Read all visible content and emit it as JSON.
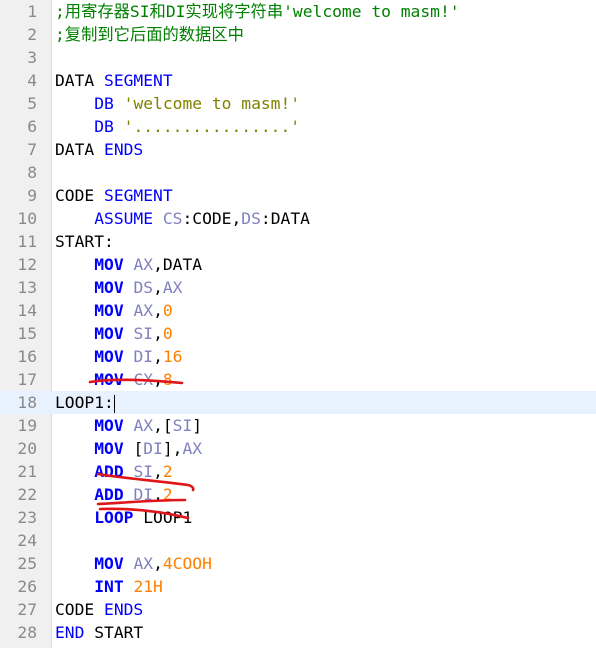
{
  "editor": {
    "current_line": 18,
    "lines": [
      {
        "n": "1",
        "tokens": [
          {
            "t": ";用寄存器SI和DI实现将字符串'welcome to masm!'",
            "k": "comment"
          }
        ]
      },
      {
        "n": "2",
        "tokens": [
          {
            "t": ";复制到它后面的数据区中",
            "k": "comment"
          }
        ]
      },
      {
        "n": "3",
        "tokens": []
      },
      {
        "n": "4",
        "tokens": [
          {
            "t": "DATA ",
            "k": "id"
          },
          {
            "t": "SEGMENT",
            "k": "kw"
          }
        ]
      },
      {
        "n": "5",
        "tokens": [
          {
            "t": "    ",
            "k": "id"
          },
          {
            "t": "DB",
            "k": "kw"
          },
          {
            "t": " ",
            "k": "id"
          },
          {
            "t": "'welcome to masm!'",
            "k": "str"
          }
        ]
      },
      {
        "n": "6",
        "tokens": [
          {
            "t": "    ",
            "k": "id"
          },
          {
            "t": "DB",
            "k": "kw"
          },
          {
            "t": " ",
            "k": "id"
          },
          {
            "t": "'................'",
            "k": "str"
          }
        ]
      },
      {
        "n": "7",
        "tokens": [
          {
            "t": "DATA ",
            "k": "id"
          },
          {
            "t": "ENDS",
            "k": "kw"
          }
        ]
      },
      {
        "n": "8",
        "tokens": []
      },
      {
        "n": "9",
        "tokens": [
          {
            "t": "CODE ",
            "k": "id"
          },
          {
            "t": "SEGMENT",
            "k": "kw"
          }
        ]
      },
      {
        "n": "10",
        "tokens": [
          {
            "t": "    ",
            "k": "id"
          },
          {
            "t": "ASSUME",
            "k": "kw"
          },
          {
            "t": " ",
            "k": "id"
          },
          {
            "t": "CS",
            "k": "reg"
          },
          {
            "t": ":CODE,",
            "k": "id"
          },
          {
            "t": "DS",
            "k": "reg"
          },
          {
            "t": ":DATA",
            "k": "id"
          }
        ]
      },
      {
        "n": "11",
        "tokens": [
          {
            "t": "START:",
            "k": "id"
          }
        ]
      },
      {
        "n": "12",
        "tokens": [
          {
            "t": "    ",
            "k": "id"
          },
          {
            "t": "MOV",
            "k": "kwb"
          },
          {
            "t": " ",
            "k": "id"
          },
          {
            "t": "AX",
            "k": "reg"
          },
          {
            "t": ",DATA",
            "k": "id"
          }
        ]
      },
      {
        "n": "13",
        "tokens": [
          {
            "t": "    ",
            "k": "id"
          },
          {
            "t": "MOV",
            "k": "kwb"
          },
          {
            "t": " ",
            "k": "id"
          },
          {
            "t": "DS",
            "k": "reg"
          },
          {
            "t": ",",
            "k": "id"
          },
          {
            "t": "AX",
            "k": "reg"
          }
        ]
      },
      {
        "n": "14",
        "tokens": [
          {
            "t": "    ",
            "k": "id"
          },
          {
            "t": "MOV",
            "k": "kwb"
          },
          {
            "t": " ",
            "k": "id"
          },
          {
            "t": "AX",
            "k": "reg"
          },
          {
            "t": ",",
            "k": "id"
          },
          {
            "t": "0",
            "k": "num"
          }
        ]
      },
      {
        "n": "15",
        "tokens": [
          {
            "t": "    ",
            "k": "id"
          },
          {
            "t": "MOV",
            "k": "kwb"
          },
          {
            "t": " ",
            "k": "id"
          },
          {
            "t": "SI",
            "k": "reg"
          },
          {
            "t": ",",
            "k": "id"
          },
          {
            "t": "0",
            "k": "num"
          }
        ]
      },
      {
        "n": "16",
        "tokens": [
          {
            "t": "    ",
            "k": "id"
          },
          {
            "t": "MOV",
            "k": "kwb"
          },
          {
            "t": " ",
            "k": "id"
          },
          {
            "t": "DI",
            "k": "reg"
          },
          {
            "t": ",",
            "k": "id"
          },
          {
            "t": "16",
            "k": "num"
          }
        ]
      },
      {
        "n": "17",
        "tokens": [
          {
            "t": "    ",
            "k": "id"
          },
          {
            "t": "MOV",
            "k": "kwb"
          },
          {
            "t": " ",
            "k": "id"
          },
          {
            "t": "CX",
            "k": "reg"
          },
          {
            "t": ",",
            "k": "id"
          },
          {
            "t": "8",
            "k": "num"
          }
        ]
      },
      {
        "n": "18",
        "tokens": [
          {
            "t": "LOOP1:",
            "k": "id"
          }
        ]
      },
      {
        "n": "19",
        "tokens": [
          {
            "t": "    ",
            "k": "id"
          },
          {
            "t": "MOV",
            "k": "kwb"
          },
          {
            "t": " ",
            "k": "id"
          },
          {
            "t": "AX",
            "k": "reg"
          },
          {
            "t": ",[",
            "k": "id"
          },
          {
            "t": "SI",
            "k": "reg"
          },
          {
            "t": "]",
            "k": "id"
          }
        ]
      },
      {
        "n": "20",
        "tokens": [
          {
            "t": "    ",
            "k": "id"
          },
          {
            "t": "MOV",
            "k": "kwb"
          },
          {
            "t": " [",
            "k": "id"
          },
          {
            "t": "DI",
            "k": "reg"
          },
          {
            "t": "],",
            "k": "id"
          },
          {
            "t": "AX",
            "k": "reg"
          }
        ]
      },
      {
        "n": "21",
        "tokens": [
          {
            "t": "    ",
            "k": "id"
          },
          {
            "t": "ADD",
            "k": "kwb"
          },
          {
            "t": " ",
            "k": "id"
          },
          {
            "t": "SI",
            "k": "reg"
          },
          {
            "t": ",",
            "k": "id"
          },
          {
            "t": "2",
            "k": "num"
          }
        ]
      },
      {
        "n": "22",
        "tokens": [
          {
            "t": "    ",
            "k": "id"
          },
          {
            "t": "ADD",
            "k": "kwb"
          },
          {
            "t": " ",
            "k": "id"
          },
          {
            "t": "DI",
            "k": "reg"
          },
          {
            "t": ",",
            "k": "id"
          },
          {
            "t": "2",
            "k": "num"
          }
        ]
      },
      {
        "n": "23",
        "tokens": [
          {
            "t": "    ",
            "k": "id"
          },
          {
            "t": "LOOP",
            "k": "kwb"
          },
          {
            "t": " LOOP1",
            "k": "id"
          }
        ]
      },
      {
        "n": "24",
        "tokens": []
      },
      {
        "n": "25",
        "tokens": [
          {
            "t": "    ",
            "k": "id"
          },
          {
            "t": "MOV",
            "k": "kwb"
          },
          {
            "t": " ",
            "k": "id"
          },
          {
            "t": "AX",
            "k": "reg"
          },
          {
            "t": ",",
            "k": "id"
          },
          {
            "t": "4COOH",
            "k": "num"
          }
        ]
      },
      {
        "n": "26",
        "tokens": [
          {
            "t": "    ",
            "k": "id"
          },
          {
            "t": "INT",
            "k": "kwb"
          },
          {
            "t": " ",
            "k": "id"
          },
          {
            "t": "21H",
            "k": "num"
          }
        ]
      },
      {
        "n": "27",
        "tokens": [
          {
            "t": "CODE ",
            "k": "id"
          },
          {
            "t": "ENDS",
            "k": "kw"
          }
        ]
      },
      {
        "n": "28",
        "tokens": [
          {
            "t": "END",
            "k": "kw"
          },
          {
            "t": " START",
            "k": "id"
          }
        ]
      }
    ]
  },
  "annotations": {
    "color": "#e0151a",
    "count": 4
  },
  "colors": {
    "gutter_bg": "#f0f0f0",
    "current_line_bg": "#e8f2fe",
    "comment": "#008000",
    "keyword": "#0000ff",
    "register": "#8080c0",
    "number": "#ff8000",
    "string": "#808000"
  }
}
